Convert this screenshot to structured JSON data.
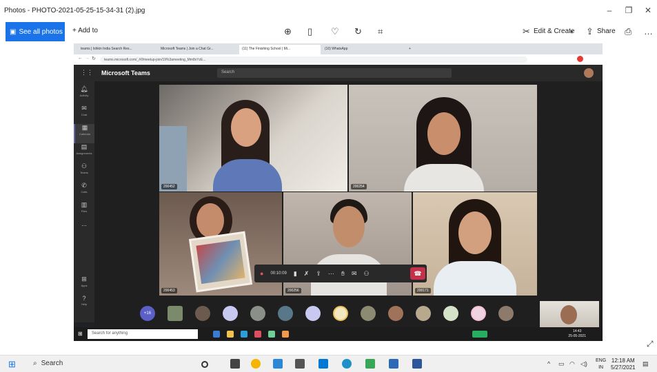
{
  "photos_app": {
    "title": "Photos - PHOTO-2021-05-25-15-34-31 (2).jpg",
    "see_all_photos": "See all photos",
    "add_to": "+ Add to",
    "edit_create": "Edit & Create",
    "share": "Share"
  },
  "browser": {
    "tabs": [
      "teams | Ishkin India Search Res...",
      "Microsoft Teams | Join a Chat Gr...",
      "(11) The Finishing School | Mi...",
      "(10) WhatsApp"
    ],
    "url": "teams.microsoft.com/_#/l/meetup-join/19%3ameeting_Mm8xYzE..."
  },
  "teams": {
    "app_name": "Microsoft Teams",
    "search_placeholder": "Search",
    "rail": [
      "Activity",
      "Chat",
      "Calendar",
      "Assignments",
      "Teams",
      "Calls",
      "Files",
      "...",
      "Apps",
      "Help"
    ],
    "tiles": [
      {
        "name": "200452"
      },
      {
        "name": "200254"
      },
      {
        "name": "200453"
      },
      {
        "name": "200256"
      },
      {
        "name": "200171"
      }
    ],
    "call_timer": "00:10:09",
    "strip_count": "+16"
  },
  "inner_taskbar": {
    "search": "Search for anything",
    "time": "14:43",
    "date": "25-05-2021"
  },
  "windows": {
    "search": "Search",
    "lang": "ENG",
    "region": "IN",
    "time": "12:18 AM",
    "date": "5/27/2021"
  },
  "colors": {
    "accent": "#1a73e8",
    "teams_purple": "#6264a7",
    "hangup": "#c4314b"
  }
}
